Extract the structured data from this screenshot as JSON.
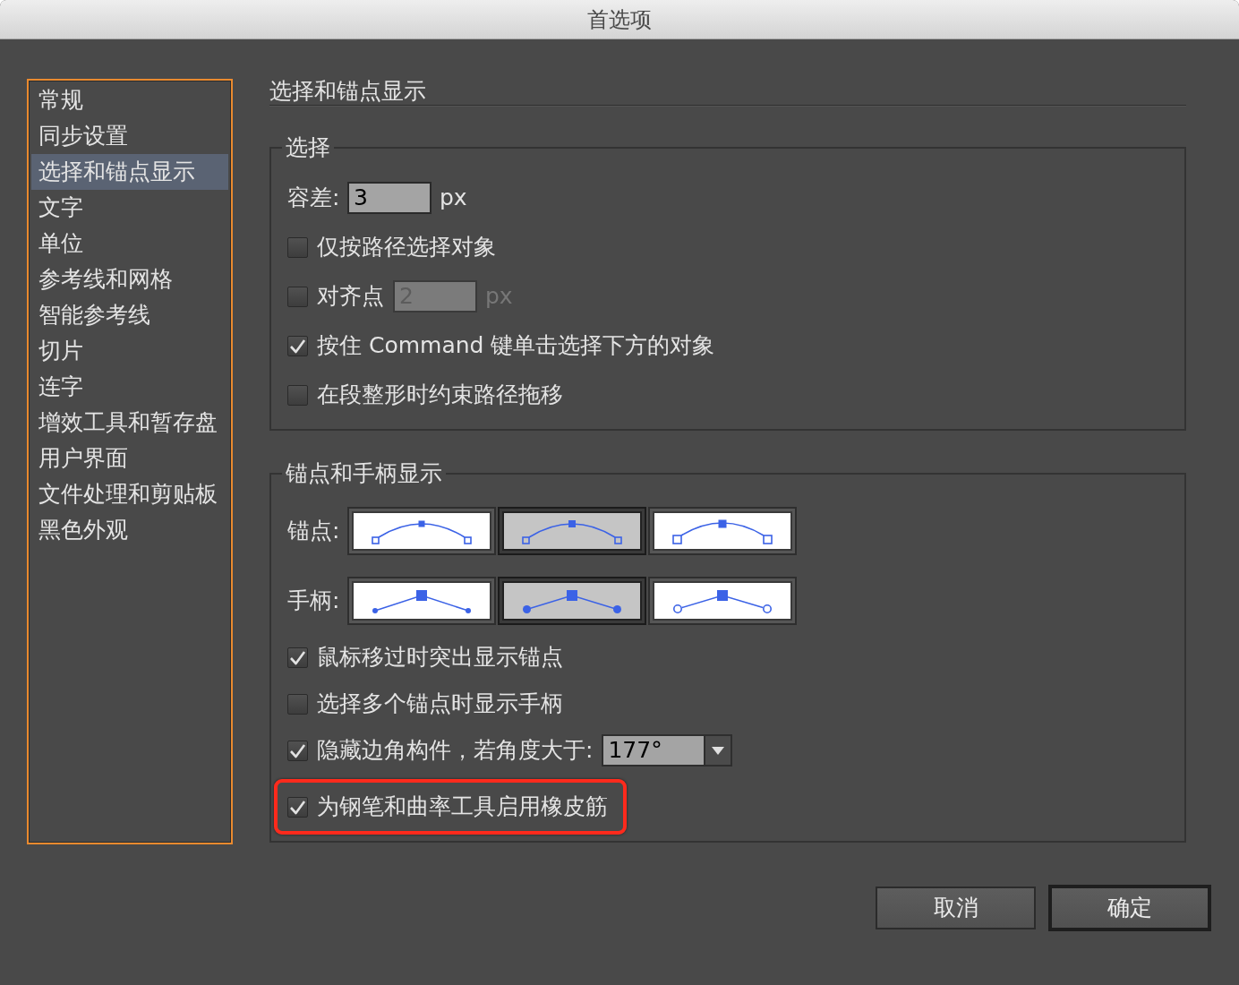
{
  "window": {
    "title": "首选项"
  },
  "sidebar": {
    "items": [
      {
        "label": "常规",
        "selected": false
      },
      {
        "label": "同步设置",
        "selected": false
      },
      {
        "label": "选择和锚点显示",
        "selected": true
      },
      {
        "label": "文字",
        "selected": false
      },
      {
        "label": "单位",
        "selected": false
      },
      {
        "label": "参考线和网格",
        "selected": false
      },
      {
        "label": "智能参考线",
        "selected": false
      },
      {
        "label": "切片",
        "selected": false
      },
      {
        "label": "连字",
        "selected": false
      },
      {
        "label": "增效工具和暂存盘",
        "selected": false
      },
      {
        "label": "用户界面",
        "selected": false
      },
      {
        "label": "文件处理和剪贴板",
        "selected": false
      },
      {
        "label": "黑色外观",
        "selected": false
      }
    ]
  },
  "panel": {
    "title": "选择和锚点显示",
    "groups": [
      {
        "title": "选择",
        "rows": [
          {
            "kind": "number",
            "label": "容差:",
            "value": "3",
            "unit": "px",
            "disabled": false,
            "highlighted": false
          },
          {
            "kind": "checkbox",
            "label": "仅按路径选择对象",
            "checked": false,
            "highlighted": false
          },
          {
            "kind": "checkbox_number",
            "label": "对齐点",
            "checked": false,
            "value": "2",
            "unit": "px",
            "disabled": true,
            "highlighted": false
          },
          {
            "kind": "checkbox",
            "label": "按住 Command 键单击选择下方的对象",
            "checked": true,
            "highlighted": false
          },
          {
            "kind": "checkbox",
            "label": "在段整形时约束路径拖移",
            "checked": false,
            "highlighted": false
          }
        ]
      },
      {
        "title": "锚点和手柄显示",
        "rows": [
          {
            "kind": "anchor_styles",
            "label": "锚点:",
            "highlighted": false,
            "options": [
              {
                "kind": "small",
                "selected": false
              },
              {
                "kind": "medium",
                "selected": true
              },
              {
                "kind": "large",
                "selected": false
              }
            ]
          },
          {
            "kind": "handle_styles",
            "label": "手柄:",
            "highlighted": false,
            "options": [
              {
                "kind": "small",
                "selected": false
              },
              {
                "kind": "medium",
                "selected": true
              },
              {
                "kind": "hollow",
                "selected": false
              }
            ]
          },
          {
            "kind": "checkbox",
            "label": "鼠标移过时突出显示锚点",
            "checked": true,
            "highlighted": false
          },
          {
            "kind": "checkbox",
            "label": "选择多个锚点时显示手柄",
            "checked": false,
            "highlighted": false
          },
          {
            "kind": "checkbox_dropdown",
            "label": "隐藏边角构件，若角度大于:",
            "checked": true,
            "value": "177°",
            "highlighted": false
          },
          {
            "kind": "checkbox",
            "label": "为钢笔和曲率工具启用橡皮筋",
            "checked": true,
            "highlighted": true
          }
        ]
      }
    ]
  },
  "buttons": [
    {
      "label": "取消",
      "default": false
    },
    {
      "label": "确定",
      "default": true
    }
  ]
}
